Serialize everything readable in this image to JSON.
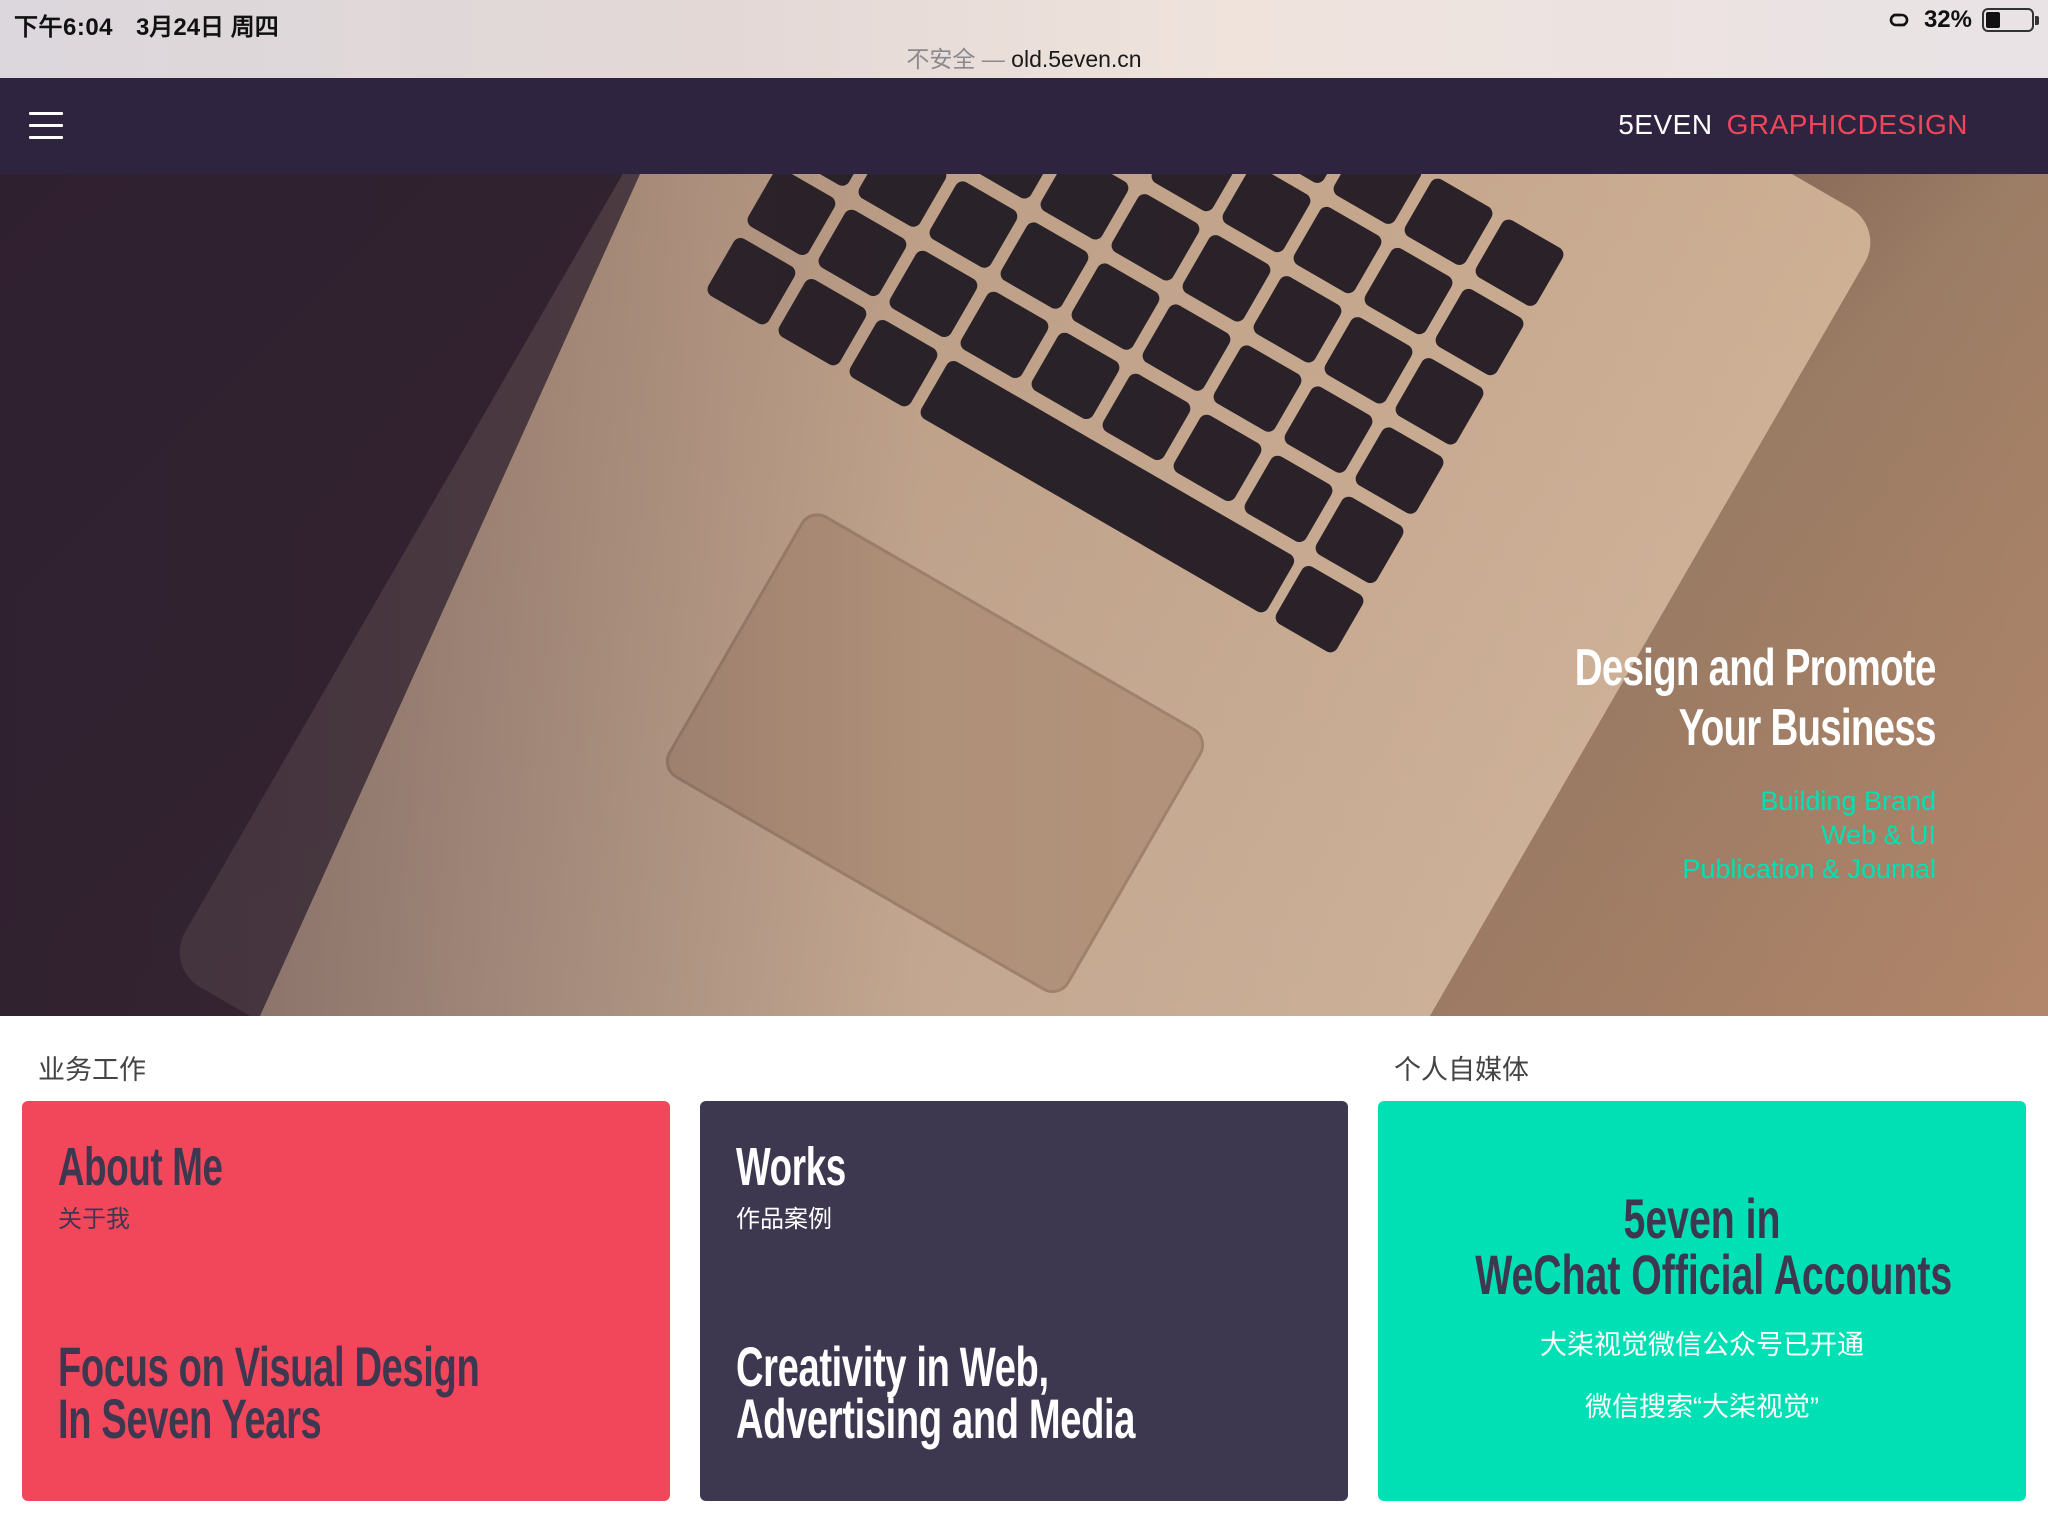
{
  "status_bar": {
    "time": "下午6:04",
    "date": "3月24日 周四",
    "battery_percent": "32%",
    "battery_level": 0.32
  },
  "browser": {
    "insecure_label": "不安全",
    "separator": " — ",
    "host": "old.5even.cn"
  },
  "header": {
    "brand_primary": "5EVEN",
    "brand_secondary": "GRAPHICDESIGN",
    "background": "#2e2440",
    "accent": "#f0455a"
  },
  "hero": {
    "title_line1": "Design and Promote",
    "title_line2": "Your Business",
    "sub_line1": "Building Brand",
    "sub_line2": "Web & UI",
    "sub_line3": "Publication & Journal",
    "sub_color": "#00e0b4"
  },
  "sections": {
    "business": "业务工作",
    "media": "个人自媒体"
  },
  "cards": {
    "about": {
      "title": "About Me",
      "cn": "关于我",
      "tag_line1": "Focus on Visual Design",
      "tag_line2": "In Seven Years",
      "color": "#f2475a"
    },
    "works": {
      "title": "Works",
      "cn": "作品案例",
      "tag_line1": "Creativity in Web,",
      "tag_line2": "Advertising and Media",
      "color": "#3d3750"
    },
    "wechat": {
      "title_line1": "5even in",
      "title_line2": "WeChat Official Accounts",
      "line1": "大柒视觉微信公众号已开通",
      "line2": "微信搜索“大柒视觉”",
      "color": "#00e0b5"
    }
  }
}
